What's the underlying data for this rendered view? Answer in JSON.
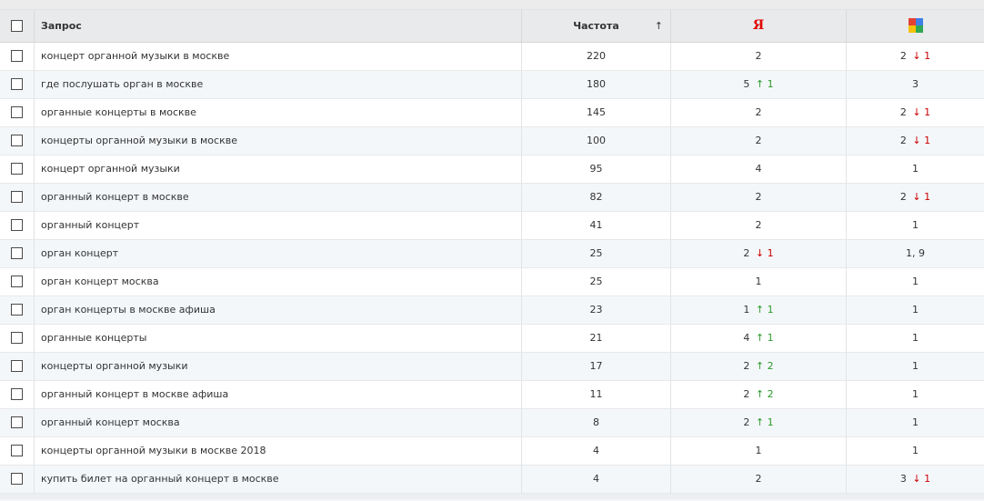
{
  "header": {
    "query": "Запрос",
    "frequency": "Частота",
    "sort_arrow": "↑",
    "yandex_icon_text": "Я",
    "google_icon": "google-icon"
  },
  "colors": {
    "down": "#cc0000",
    "up": "#2b9a2b",
    "yandex": "#e00000"
  },
  "rows": [
    {
      "query": "концерт органной музыки в москве",
      "freq": "220",
      "y": "2",
      "y_dir": "",
      "y_delta": "",
      "g": "2",
      "g_dir": "↓",
      "g_delta": "1"
    },
    {
      "query": "где послушать орган в москве",
      "freq": "180",
      "y": "5",
      "y_dir": "↑",
      "y_delta": "1",
      "g": "3",
      "g_dir": "",
      "g_delta": ""
    },
    {
      "query": "органные концерты в москве",
      "freq": "145",
      "y": "2",
      "y_dir": "",
      "y_delta": "",
      "g": "2",
      "g_dir": "↓",
      "g_delta": "1"
    },
    {
      "query": "концерты органной музыки в москве",
      "freq": "100",
      "y": "2",
      "y_dir": "",
      "y_delta": "",
      "g": "2",
      "g_dir": "↓",
      "g_delta": "1"
    },
    {
      "query": "концерт органной музыки",
      "freq": "95",
      "y": "4",
      "y_dir": "",
      "y_delta": "",
      "g": "1",
      "g_dir": "",
      "g_delta": ""
    },
    {
      "query": "органный концерт в москве",
      "freq": "82",
      "y": "2",
      "y_dir": "",
      "y_delta": "",
      "g": "2",
      "g_dir": "↓",
      "g_delta": "1"
    },
    {
      "query": "органный концерт",
      "freq": "41",
      "y": "2",
      "y_dir": "",
      "y_delta": "",
      "g": "1",
      "g_dir": "",
      "g_delta": ""
    },
    {
      "query": "орган концерт",
      "freq": "25",
      "y": "2",
      "y_dir": "↓",
      "y_delta": "1",
      "g": "1, 9",
      "g_dir": "",
      "g_delta": ""
    },
    {
      "query": "орган концерт москва",
      "freq": "25",
      "y": "1",
      "y_dir": "",
      "y_delta": "",
      "g": "1",
      "g_dir": "",
      "g_delta": ""
    },
    {
      "query": "орган концерты в москве афиша",
      "freq": "23",
      "y": "1",
      "y_dir": "↑",
      "y_delta": "1",
      "g": "1",
      "g_dir": "",
      "g_delta": ""
    },
    {
      "query": "органные концерты",
      "freq": "21",
      "y": "4",
      "y_dir": "↑",
      "y_delta": "1",
      "g": "1",
      "g_dir": "",
      "g_delta": ""
    },
    {
      "query": "концерты органной музыки",
      "freq": "17",
      "y": "2",
      "y_dir": "↑",
      "y_delta": "2",
      "g": "1",
      "g_dir": "",
      "g_delta": ""
    },
    {
      "query": "органный концерт в москве афиша",
      "freq": "11",
      "y": "2",
      "y_dir": "↑",
      "y_delta": "2",
      "g": "1",
      "g_dir": "",
      "g_delta": ""
    },
    {
      "query": "органный концерт москва",
      "freq": "8",
      "y": "2",
      "y_dir": "↑",
      "y_delta": "1",
      "g": "1",
      "g_dir": "",
      "g_delta": ""
    },
    {
      "query": "концерты органной музыки в москве 2018",
      "freq": "4",
      "y": "1",
      "y_dir": "",
      "y_delta": "",
      "g": "1",
      "g_dir": "",
      "g_delta": ""
    },
    {
      "query": "купить билет на органный концерт в москве",
      "freq": "4",
      "y": "2",
      "y_dir": "",
      "y_delta": "",
      "g": "3",
      "g_dir": "↓",
      "g_delta": "1"
    }
  ]
}
